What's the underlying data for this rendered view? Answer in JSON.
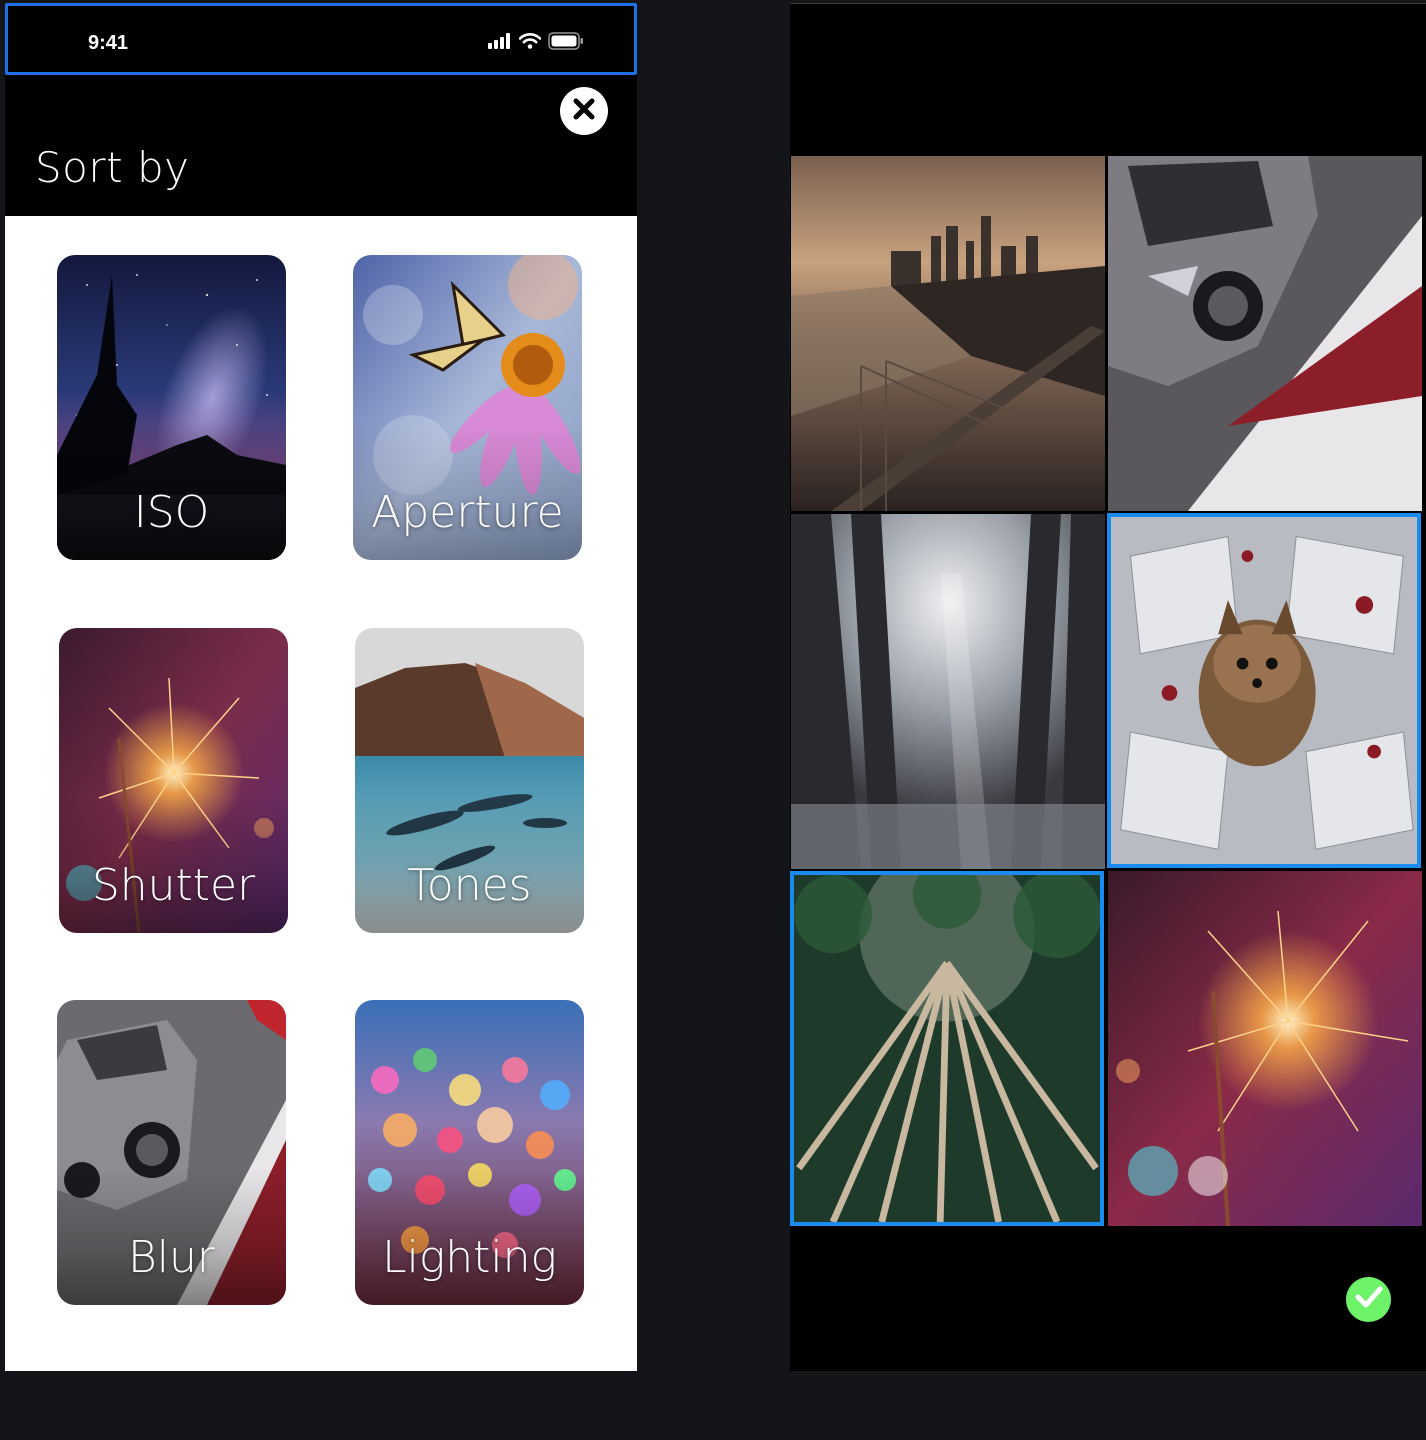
{
  "status_bar": {
    "time": "9:41"
  },
  "sort_sheet": {
    "title": "Sort by",
    "options": [
      {
        "label": "ISO"
      },
      {
        "label": "Aperture"
      },
      {
        "label": "Shutter"
      },
      {
        "label": "Tones"
      },
      {
        "label": "Blur"
      },
      {
        "label": "Lighting"
      }
    ]
  },
  "photo_grid": {
    "photos": [
      {
        "subject": "city-bridge-aerial",
        "selected": false
      },
      {
        "subject": "sports-car-track",
        "selected": false
      },
      {
        "subject": "snowy-forest-sunrays",
        "selected": false
      },
      {
        "subject": "dog-on-open-books",
        "selected": true
      },
      {
        "subject": "tall-trees-looking-up",
        "selected": true
      },
      {
        "subject": "sparkler-bokeh",
        "selected": false
      }
    ]
  },
  "colors": {
    "selection_border": "#1a8cf0",
    "confirm_green": "#6ef26a",
    "status_highlight": "#1f6fe6"
  },
  "icons": [
    "signal-icon",
    "wifi-icon",
    "battery-icon",
    "close-icon",
    "checkmark-icon"
  ]
}
